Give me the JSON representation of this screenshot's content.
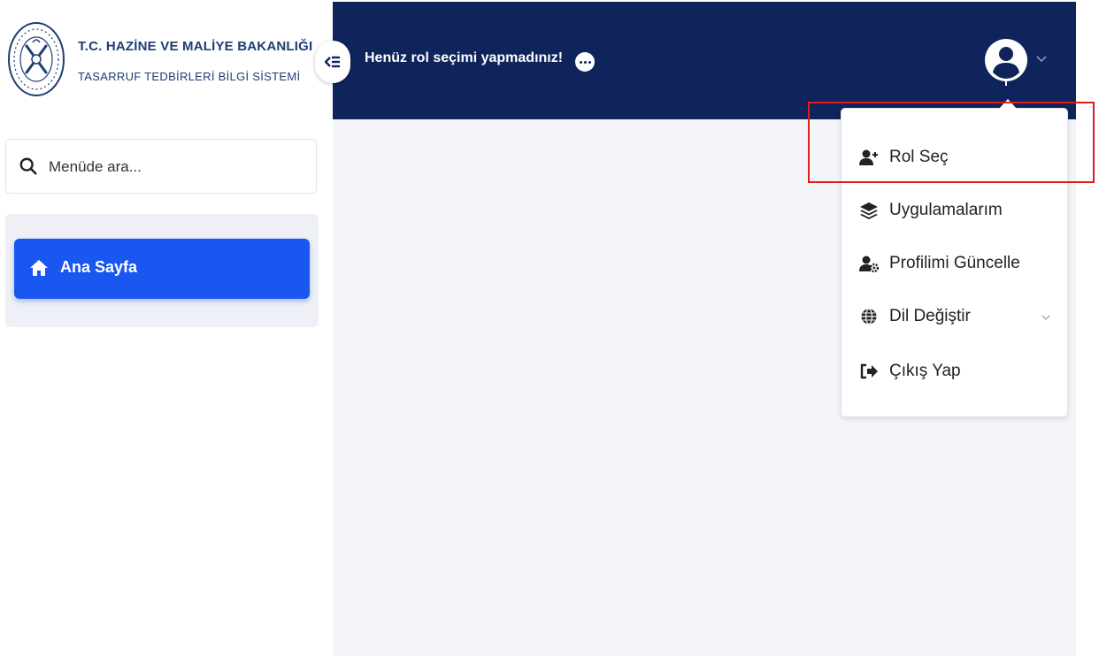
{
  "brand": {
    "title": "T.C. HAZİNE VE MALİYE BAKANLIĞI",
    "subtitle": "TASARRUF TEDBİRLERİ BİLGİ SİSTEMİ"
  },
  "search": {
    "placeholder": "Menüde ara...",
    "icon": "search-icon"
  },
  "sidebar": {
    "items": [
      {
        "label": "Ana Sayfa",
        "icon": "home-icon",
        "active": true
      }
    ]
  },
  "header": {
    "role_message": "Henüz rol seçimi yapmadınız!",
    "info_icon": "more-dots-icon",
    "avatar_icon": "user-avatar-icon"
  },
  "dropdown": {
    "items": [
      {
        "label": "Rol Seç",
        "icon": "user-plus-icon"
      },
      {
        "label": "Uygulamalarım",
        "icon": "layers-icon"
      },
      {
        "label": "Profilimi Güncelle",
        "icon": "user-gear-icon"
      },
      {
        "label": "Dil Değiştir",
        "icon": "globe-icon",
        "has_submenu": true
      },
      {
        "label": "Çıkış Yap",
        "icon": "logout-icon"
      }
    ]
  },
  "colors": {
    "header_bg": "#0f245a",
    "accent": "#1a56f0",
    "brand_text": "#1d3e74",
    "main_bg": "#f4f5f9",
    "highlight": "#e51c1c"
  }
}
